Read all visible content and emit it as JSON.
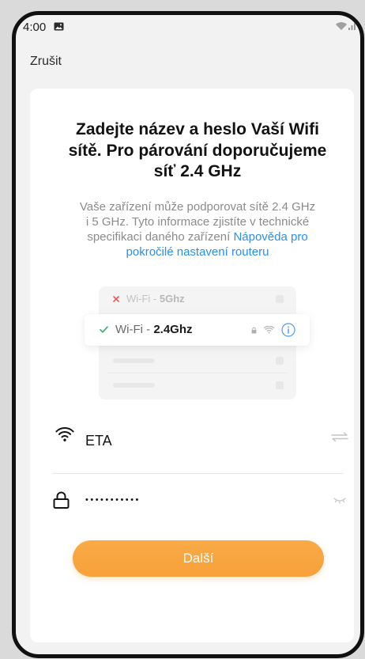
{
  "status_bar": {
    "time": "4:00",
    "left_icons": [
      "gallery-icon"
    ],
    "right_icons": [
      "wifi-status-icon",
      "signal-icon"
    ]
  },
  "header": {
    "cancel_label": "Zrušit"
  },
  "title_lines": [
    "Zadejte název a heslo Vaší Wifi",
    "sítě. Pro párování doporučujeme",
    "síť 2.4 GHz"
  ],
  "description": {
    "lines": [
      "Vaše zařízení může podporovat sítě 2.4 GHz",
      "i 5 GHz. Tyto informace zjistíte v technické",
      "specifikaci daného zařízení"
    ],
    "link_lines": [
      "Nápověda pro",
      "pokročilé nastavení routeru"
    ]
  },
  "illustration": {
    "networks": [
      {
        "prefix": "Wi-Fi - ",
        "band": "5Ghz",
        "icon": "cross-icon"
      },
      {
        "prefix": "Wi-Fi - ",
        "band": "2.4Ghz",
        "icon": "check-icon",
        "trailing_icons": [
          "lock-icon",
          "wifi-icon",
          "info-icon"
        ]
      }
    ]
  },
  "wifi_field": {
    "icon": "wifi-icon",
    "value": "ETA",
    "action_icon": "swap-icon"
  },
  "password_field": {
    "icon": "lock-icon",
    "value": "•••••••••••",
    "action_icon": "eye-closed-icon"
  },
  "next_button": {
    "label": "Další"
  },
  "colors": {
    "accent": "#f7a13a",
    "link": "#2a8ef0",
    "success": "#34b36b",
    "error": "#f05a5a",
    "info": "#4a9ef5"
  }
}
